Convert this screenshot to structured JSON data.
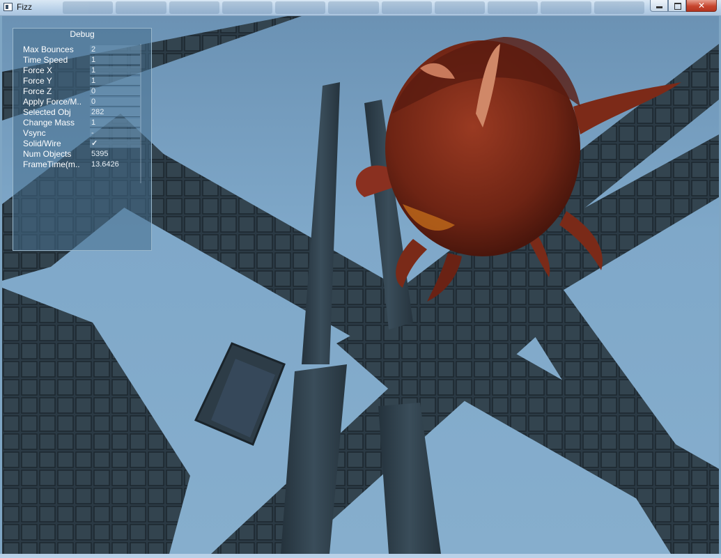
{
  "window": {
    "title": "Fizz"
  },
  "debug": {
    "title": "Debug",
    "rows": [
      {
        "label": "Max Bounces",
        "value": "2"
      },
      {
        "label": "Time Speed",
        "value": "1"
      },
      {
        "label": "Force X",
        "value": "1"
      },
      {
        "label": "Force Y",
        "value": "1"
      },
      {
        "label": "Force Z",
        "value": "0"
      },
      {
        "label": "Apply Force/M..",
        "value": "0"
      },
      {
        "label": "Selected Obj",
        "value": "282"
      },
      {
        "label": "Change Mass",
        "value": "1"
      },
      {
        "label": "Vsync",
        "value": "-"
      },
      {
        "label": "Solid/Wire",
        "value": "✓"
      },
      {
        "label": "Num Objects",
        "value": "5395"
      },
      {
        "label": "FrameTime(m..",
        "value": "13.6426"
      }
    ]
  },
  "colors": {
    "sky": "#7fa8c9",
    "beam": "#2f3f4a",
    "creature": "#7a2a1a",
    "panel": "#466e8c"
  },
  "icons": {
    "minimize": "minimize-icon",
    "maximize": "maximize-icon",
    "close": "close-icon"
  }
}
